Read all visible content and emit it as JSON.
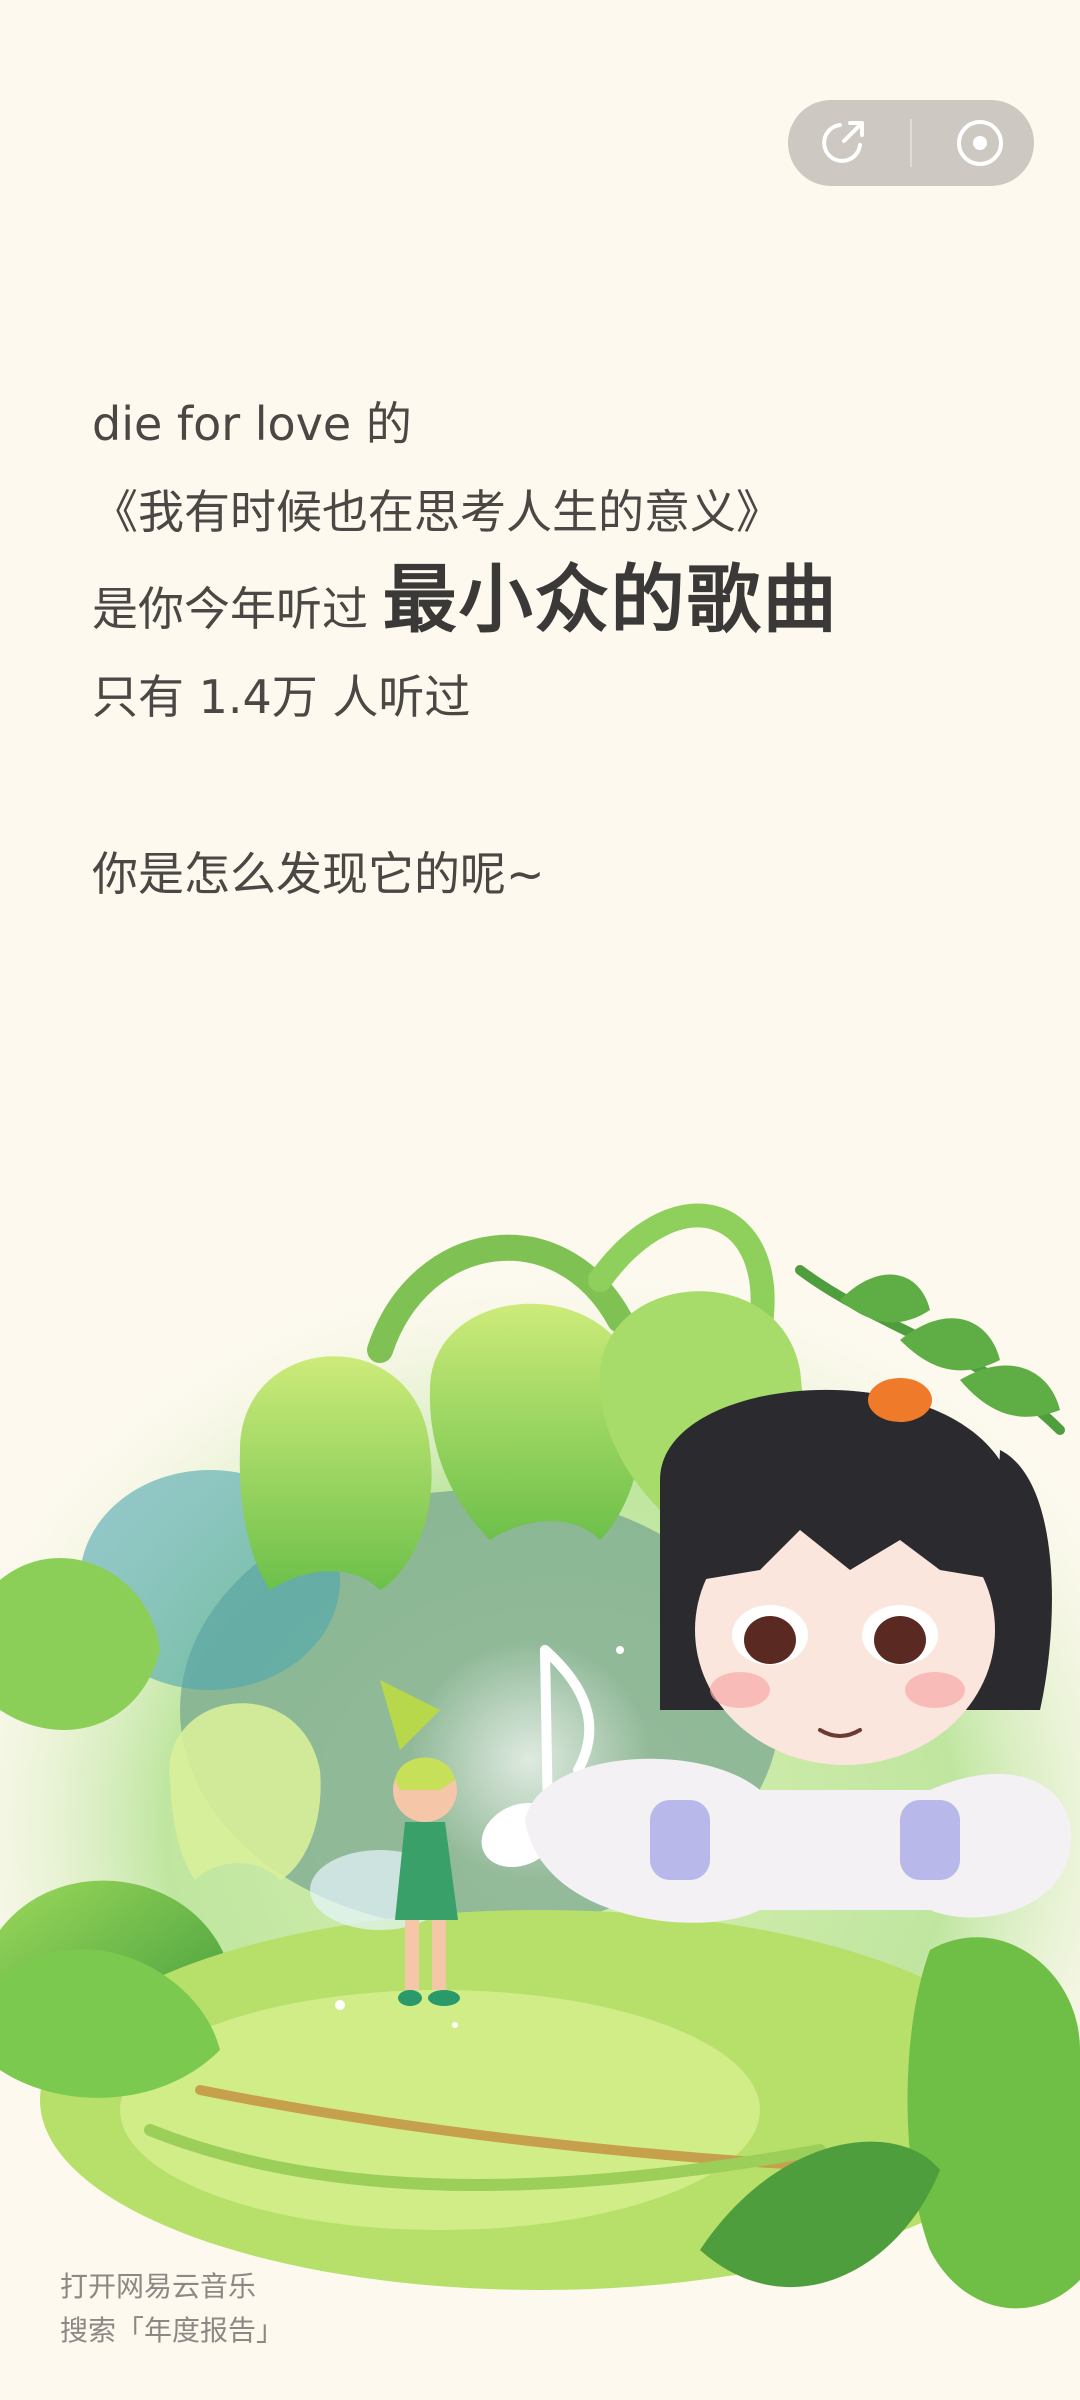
{
  "toolbar": {
    "share_icon": "share-arrow-icon",
    "record_icon": "target-dot-icon"
  },
  "content": {
    "line1": "die for love 的",
    "line2": "《我有时候也在思考人生的意义》",
    "line3_prefix": "是你今年听过 ",
    "line3_emphasis": "最小众的歌曲",
    "line4": "只有 1.4万 人听过",
    "question": "你是怎么发现它的呢~"
  },
  "footer": {
    "line1": "打开网易云音乐",
    "line2": "搜索「年度报告」"
  },
  "colors": {
    "background": "#fdf9ef",
    "text": "#4a4744",
    "highlight": "#e8f53b",
    "capsule": "#cdc9c2",
    "leaf_green": "#8fd14f"
  }
}
